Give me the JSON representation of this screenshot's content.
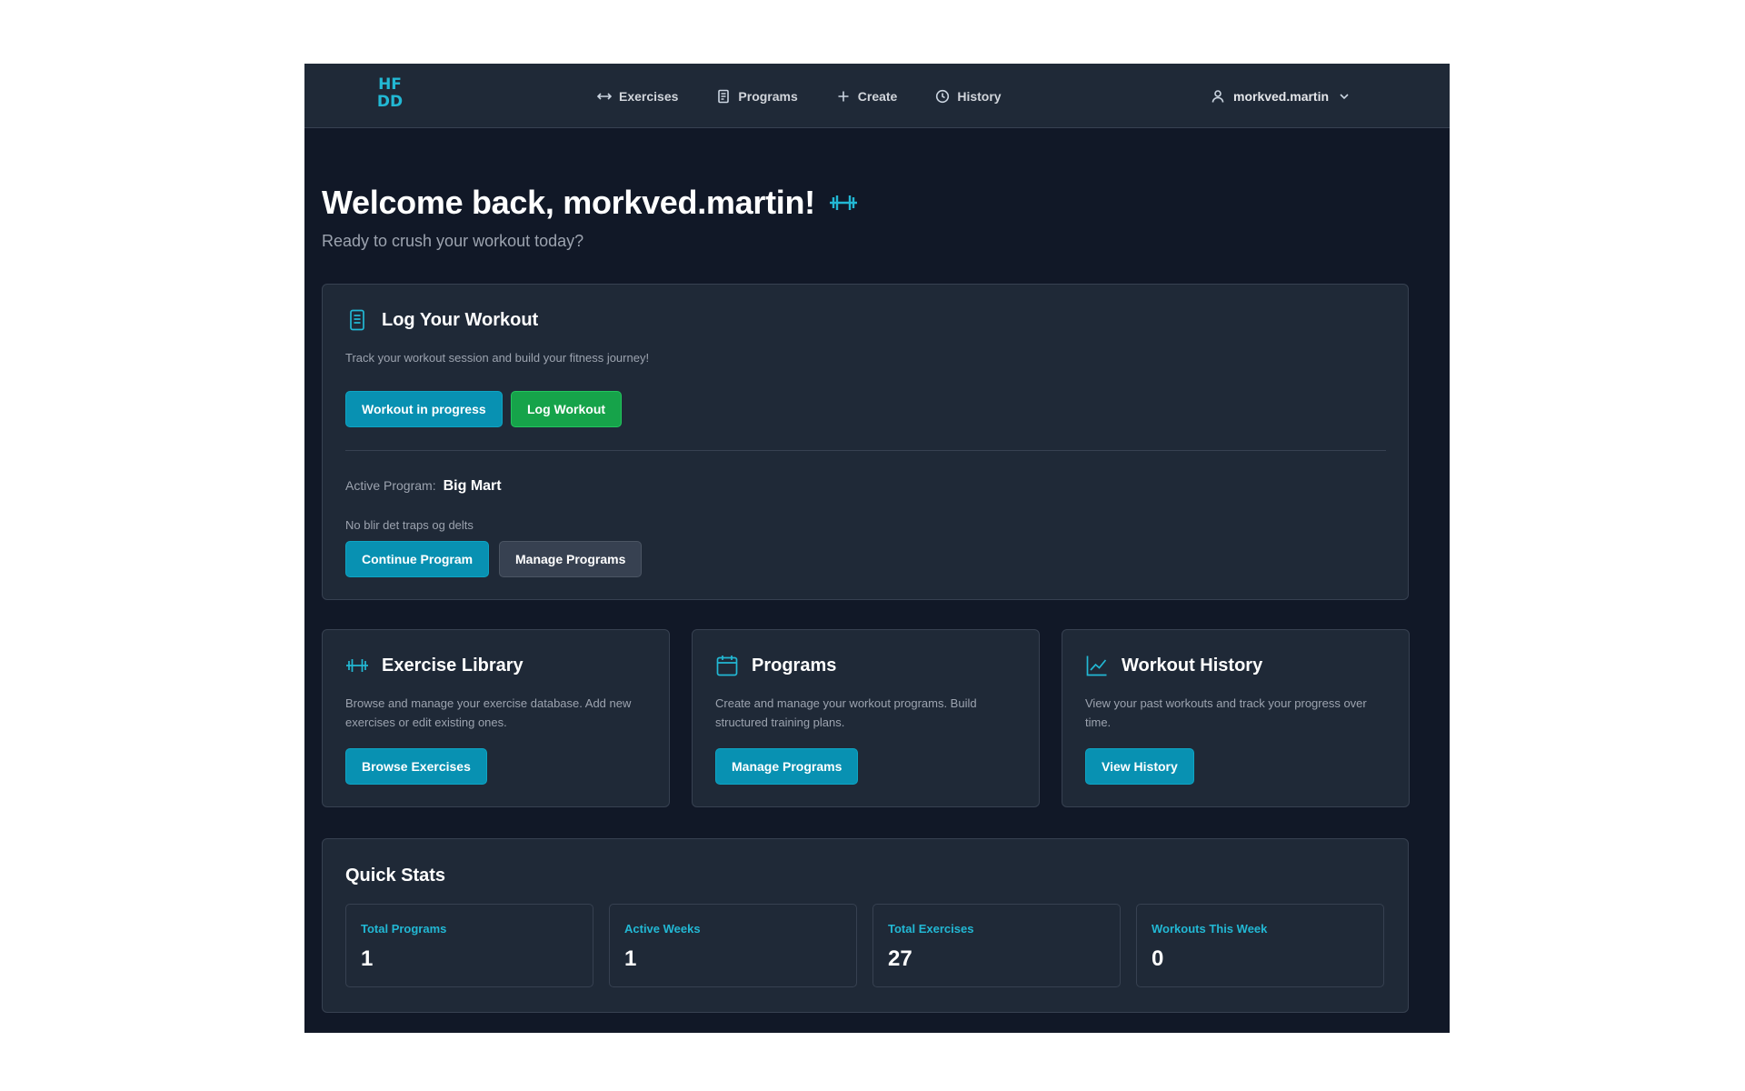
{
  "navbar": {
    "logo_line1": "HF",
    "logo_line2": "DD",
    "links": [
      {
        "label": "Exercises",
        "icon": "arrows-horizontal-icon"
      },
      {
        "label": "Programs",
        "icon": "document-icon"
      },
      {
        "label": "Create",
        "icon": "plus-icon"
      },
      {
        "label": "History",
        "icon": "clock-icon"
      }
    ],
    "user": {
      "name": "morkved.martin",
      "icon": "user-icon"
    }
  },
  "welcome": {
    "title": "Welcome back, morkved.martin!",
    "subtitle": "Ready to crush your workout today?",
    "icon": "dumbbell-icon"
  },
  "log_card": {
    "title": "Log Your Workout",
    "description": "Track your workout session and build your fitness journey!",
    "in_progress_label": "Workout in progress",
    "log_label": "Log Workout",
    "active_program_label": "Active Program:",
    "active_program_name": "Big Mart",
    "program_description": "No blir det traps og delts",
    "continue_label": "Continue Program",
    "manage_label": "Manage Programs"
  },
  "feature_cards": [
    {
      "title": "Exercise Library",
      "description": "Browse and manage your exercise database. Add new exercises or edit existing ones.",
      "button": "Browse Exercises",
      "icon": "dumbbell-icon"
    },
    {
      "title": "Programs",
      "description": "Create and manage your workout programs. Build structured training plans.",
      "button": "Manage Programs",
      "icon": "calendar-icon"
    },
    {
      "title": "Workout History",
      "description": "View your past workouts and track your progress over time.",
      "button": "View History",
      "icon": "chart-line-icon"
    }
  ],
  "quick_stats": {
    "title": "Quick Stats",
    "items": [
      {
        "label": "Total Programs",
        "value": "1"
      },
      {
        "label": "Active Weeks",
        "value": "1"
      },
      {
        "label": "Total Exercises",
        "value": "27"
      },
      {
        "label": "Workouts This Week",
        "value": "0"
      }
    ]
  },
  "colors": {
    "accent": "#22b8d4",
    "primary_button": "#0891b2",
    "success_button": "#16a34a",
    "background": "#111827",
    "card": "#1f2937"
  }
}
